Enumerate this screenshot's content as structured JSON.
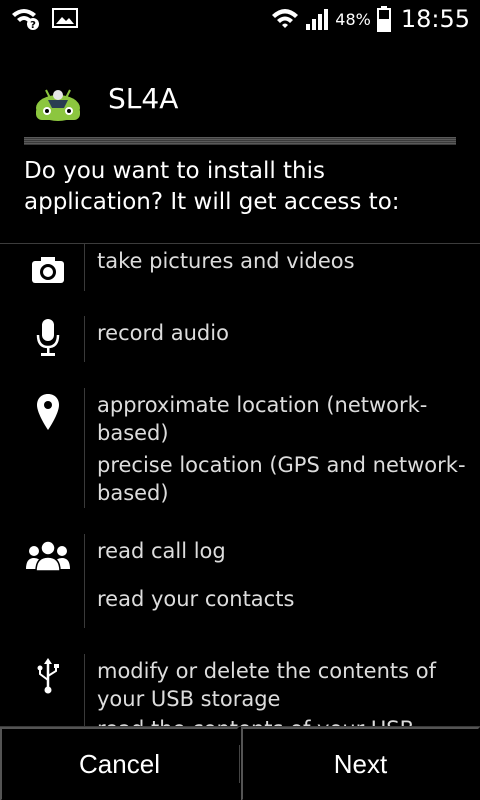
{
  "status_bar": {
    "battery_percent": "48%",
    "time": "18:55",
    "left_icons": [
      "wifi-question-icon",
      "image-icon"
    ],
    "right_icons": [
      "wifi-icon",
      "signal-icon",
      "battery-charging-icon"
    ]
  },
  "header": {
    "app_name": "SL4A",
    "app_icon": "sl4a-android-icon"
  },
  "question": "Do you want to install this application? It will get access to:",
  "permissions": [
    {
      "icon": "camera-icon",
      "items": [
        "take pictures and videos"
      ]
    },
    {
      "icon": "microphone-icon",
      "items": [
        "record audio"
      ]
    },
    {
      "icon": "location-pin-icon",
      "items": [
        "approximate location (network-based)",
        "precise location (GPS and network-based)"
      ]
    },
    {
      "icon": "contacts-icon",
      "items": [
        "read call log",
        "read your contacts"
      ]
    },
    {
      "icon": "usb-icon",
      "items": [
        "modify or delete the contents of your USB storage",
        "read the contents of your USB storage"
      ]
    }
  ],
  "buttons": {
    "cancel": "Cancel",
    "next": "Next"
  }
}
